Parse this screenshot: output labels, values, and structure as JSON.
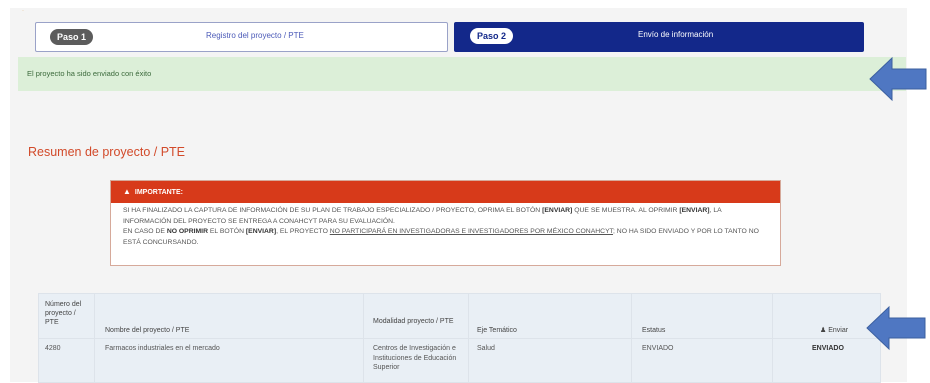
{
  "steps": [
    {
      "badge": "Paso 1",
      "label": "Registro del proyecto / PTE"
    },
    {
      "badge": "Paso 2",
      "label": "Envío de información"
    }
  ],
  "success_message": "El proyecto ha sido enviado con éxito",
  "section_title": "Resumen de proyecto / PTE",
  "warning": {
    "title": "IMPORTANTE:",
    "line1_a": "SI HA FINALIZADO LA CAPTURA DE INFORMACIÓN DE SU PLAN DE TRABAJO ESPECIALIZADO / PROYECTO, OPRIMA EL BOTÓN ",
    "line1_b": "[ENVIAR]",
    "line1_c": " QUE SE MUESTRA. AL OPRIMIR ",
    "line1_d": "[ENVIAR]",
    "line1_e": ", LA INFORMACIÓN DEL PROYECTO SE ENTREGA A CONAHCYT PARA SU EVALUACIÓN.",
    "line2_a": "EN CASO DE ",
    "line2_b": "NO OPRIMIR",
    "line2_c": " EL BOTÓN ",
    "line2_d": "[ENVIAR]",
    "line2_e": ", EL PROYECTO ",
    "line2_f": "NO PARTICIPARÁ EN INVESTIGADORAS E INVESTIGADORES POR MÉXICO CONAHCYT",
    "line2_g": "; NO HA SIDO ENVIADO Y POR LO TANTO NO ESTÁ CONCURSANDO."
  },
  "table": {
    "headers": {
      "numero": "Número del proyecto / PTE",
      "nombre": "Nombre del proyecto / PTE",
      "modalidad": "Modalidad proyecto / PTE",
      "eje": "Eje Temático",
      "estatus": "Estatus",
      "enviar": "Enviar"
    },
    "row": {
      "numero": "4280",
      "nombre": "Farmacos industriales en el mercado",
      "modalidad": "Centros de Investigación e Instituciones de Educación Superior",
      "eje": "Salud",
      "estatus": "ENVIADO",
      "enviar": "ENVIADO"
    }
  },
  "colors": {
    "primary": "#13288a",
    "danger": "#d73a1a",
    "success_bg": "#dcefd8",
    "arrow": "#4f77c2"
  }
}
